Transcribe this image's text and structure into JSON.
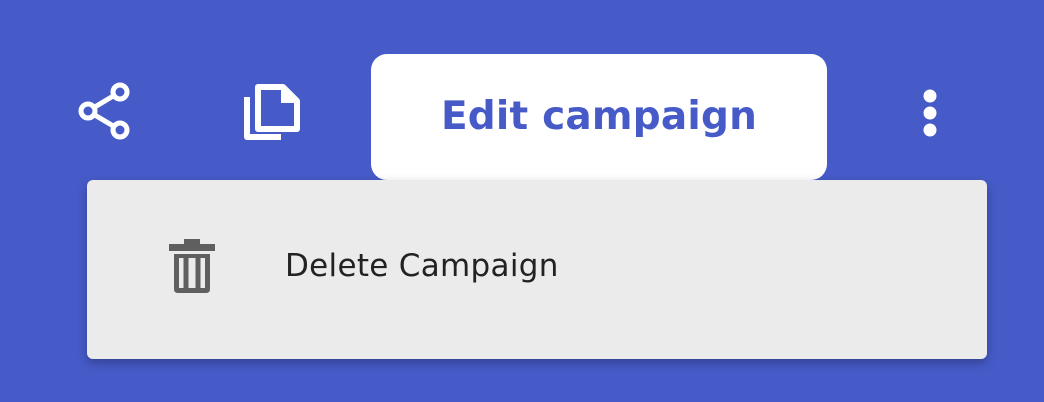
{
  "toolbar": {
    "share_icon": "share-icon",
    "copy_icon": "copy-icon",
    "edit_label": "Edit campaign",
    "more_icon": "more-vertical-icon"
  },
  "menu": {
    "items": [
      {
        "icon": "trash-icon",
        "label": "Delete Campaign"
      }
    ]
  },
  "colors": {
    "background": "#465bc8",
    "accent": "#465bc8",
    "button_bg": "#ffffff",
    "menu_bg": "#ebebeb",
    "menu_text": "#222222",
    "menu_icon": "#5f5f5f"
  }
}
